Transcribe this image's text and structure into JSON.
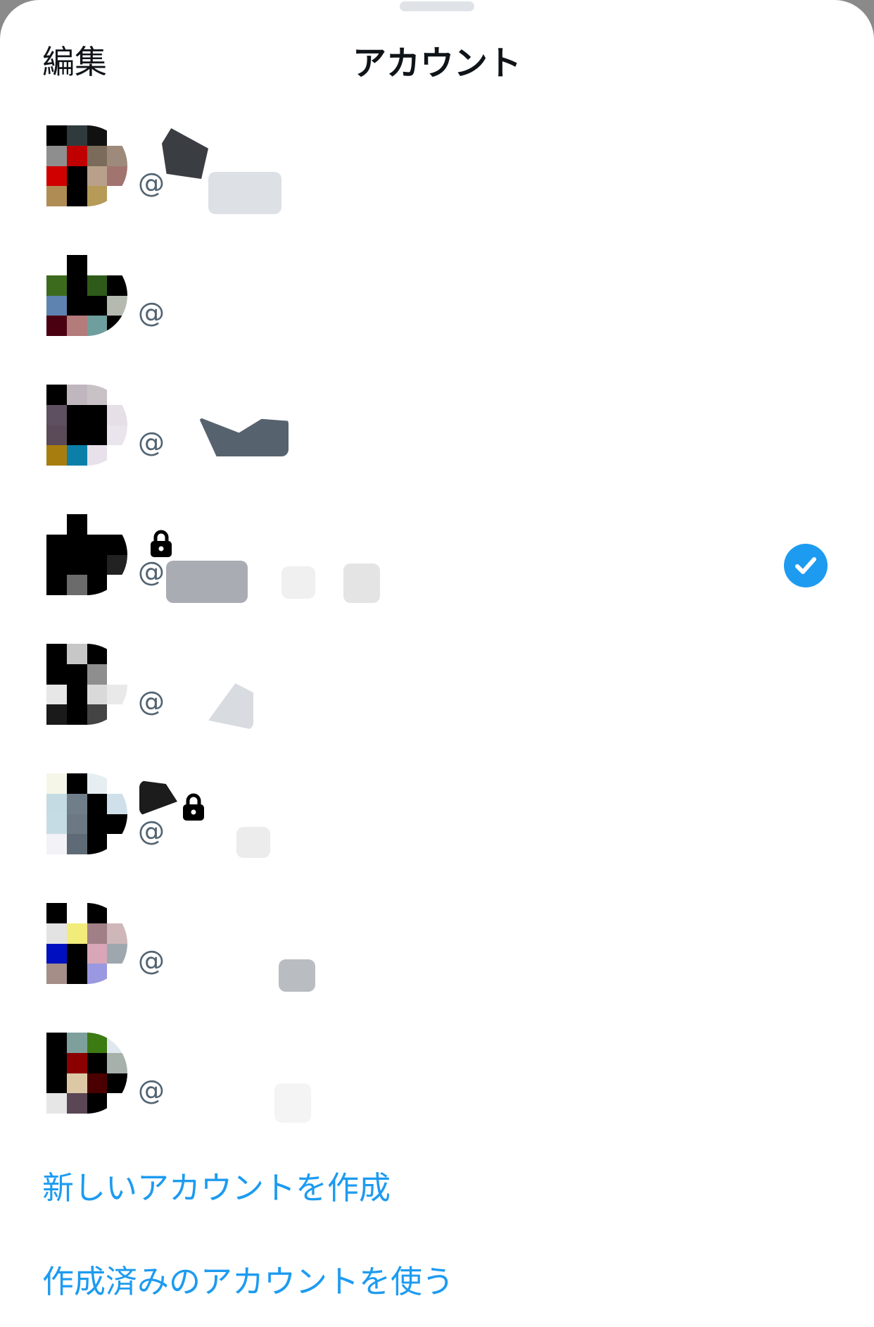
{
  "header": {
    "edit_label": "編集",
    "title": "アカウント"
  },
  "accounts": [
    {
      "handle_prefix": "@",
      "locked": false,
      "selected": false
    },
    {
      "handle_prefix": "@",
      "locked": false,
      "selected": false
    },
    {
      "handle_prefix": "@",
      "locked": false,
      "selected": false
    },
    {
      "handle_prefix": "@",
      "locked": true,
      "selected": true
    },
    {
      "handle_prefix": "@",
      "locked": false,
      "selected": false
    },
    {
      "handle_prefix": "@",
      "locked": true,
      "selected": false
    },
    {
      "handle_prefix": "@",
      "locked": false,
      "selected": false
    },
    {
      "handle_prefix": "@",
      "locked": false,
      "selected": false
    }
  ],
  "actions": {
    "create_new": "新しいアカウントを作成",
    "use_existing": "作成済みのアカウントを使う"
  },
  "colors": {
    "accent": "#1d9bf0",
    "text_primary": "#0f1419",
    "text_secondary": "#536471"
  },
  "icons": {
    "lock": "lock-icon",
    "selected": "check-circle-icon"
  }
}
